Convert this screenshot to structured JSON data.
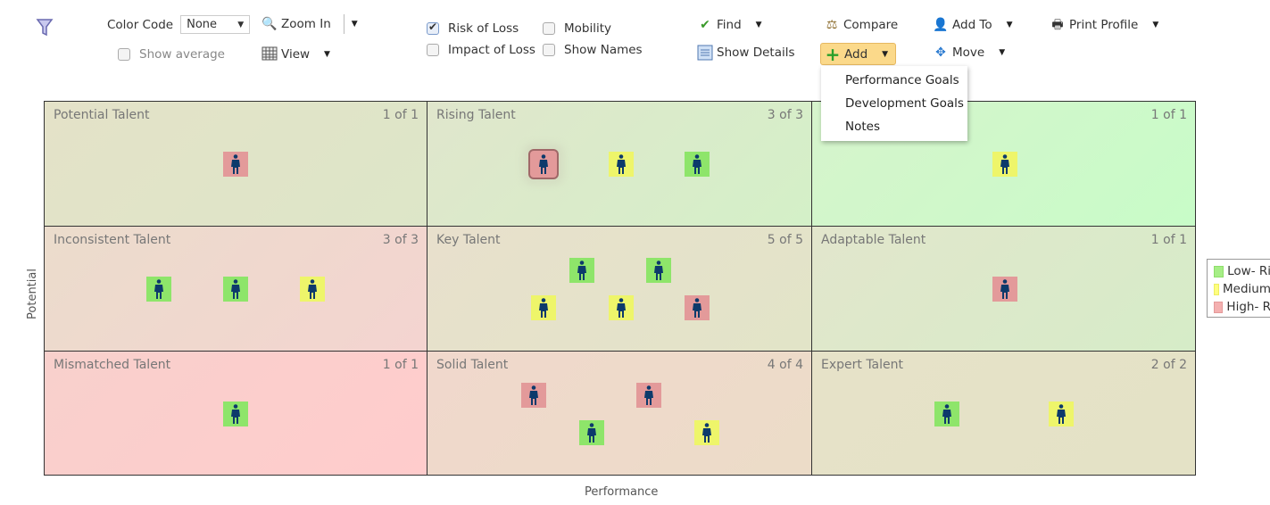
{
  "toolbar": {
    "color_code_label": "Color Code",
    "color_code_value": "None",
    "show_average": "Show average",
    "zoom_in": "Zoom In",
    "view": "View",
    "risk_of_loss": "Risk of Loss",
    "impact_of_loss": "Impact of Loss",
    "mobility": "Mobility",
    "show_names": "Show Names",
    "find": "Find",
    "show_details": "Show Details",
    "compare": "Compare",
    "add": "Add",
    "add_to": "Add To",
    "move": "Move",
    "print_profile": "Print Profile",
    "checked": {
      "risk_of_loss": true,
      "impact_of_loss": false,
      "mobility": false,
      "show_names": false,
      "show_average": false
    }
  },
  "add_menu": [
    "Performance Goals",
    "Development Goals",
    "Notes"
  ],
  "axes": {
    "x": "Performance",
    "y": "Potential"
  },
  "colors": {
    "low": "#8ee56a",
    "medium": "#eef56a",
    "high": "#e39a9a",
    "person": "#0d3a6b"
  },
  "cells": [
    {
      "title": "Potential Talent",
      "count": "1 of 1",
      "people": [
        "high"
      ]
    },
    {
      "title": "Rising Talent",
      "count": "3 of 3",
      "people": [
        "high",
        "medium",
        "low"
      ],
      "selected": 0
    },
    {
      "title": "",
      "count": "1 of 1",
      "people": [
        "medium"
      ]
    },
    {
      "title": "Inconsistent Talent",
      "count": "3 of 3",
      "people": [
        "low",
        "low",
        "medium"
      ]
    },
    {
      "title": "Key Talent",
      "count": "5 of 5",
      "people": [
        "low",
        "low",
        "medium",
        "medium",
        "high"
      ]
    },
    {
      "title": "Adaptable Talent",
      "count": "1 of 1",
      "people": [
        "high"
      ]
    },
    {
      "title": "Mismatched Talent",
      "count": "1 of 1",
      "people": [
        "low"
      ]
    },
    {
      "title": "Solid Talent",
      "count": "4 of 4",
      "people": [
        "high",
        "high",
        "low",
        "medium"
      ]
    },
    {
      "title": "Expert Talent",
      "count": "2 of 2",
      "people": [
        "low",
        "medium"
      ]
    }
  ],
  "legend": [
    {
      "level": "low",
      "label": "Low- Ri"
    },
    {
      "level": "medium",
      "label": "Medium"
    },
    {
      "level": "high",
      "label": "High- R"
    }
  ]
}
